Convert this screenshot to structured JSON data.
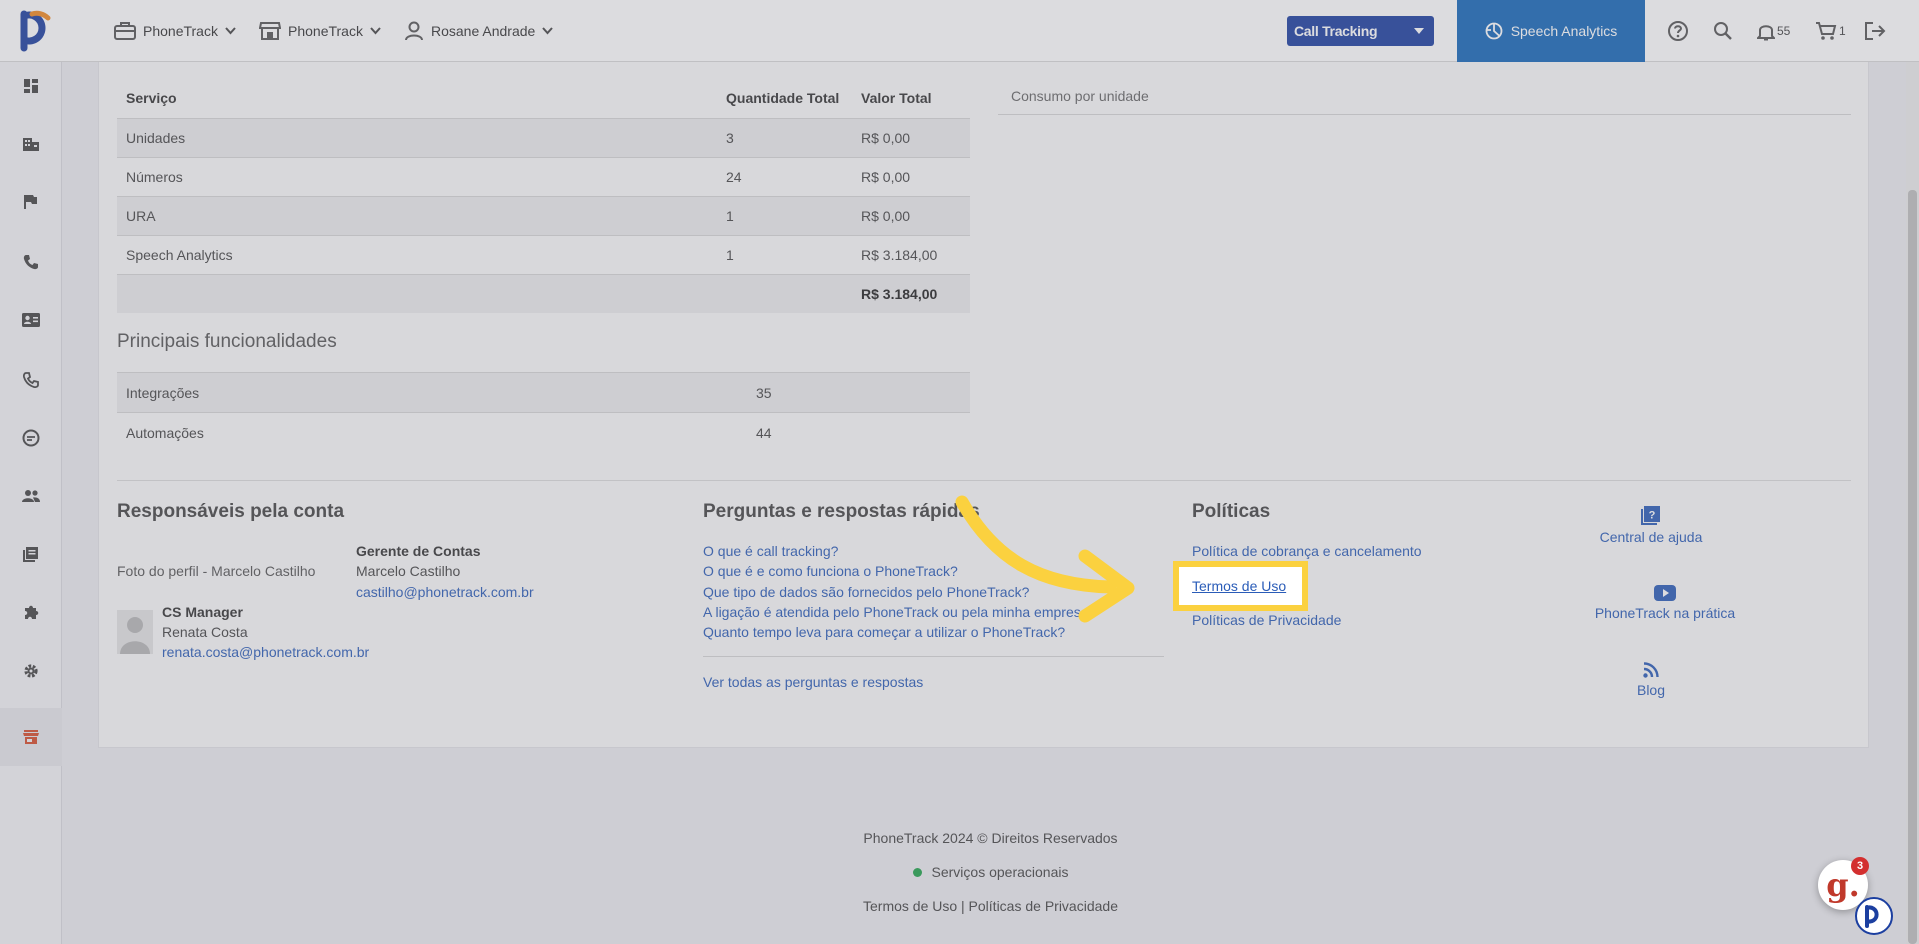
{
  "header": {
    "nav": [
      {
        "label": "PhoneTrack",
        "icon": "briefcase-icon"
      },
      {
        "label": "PhoneTrack",
        "icon": "store-icon"
      },
      {
        "label": "Rosane Andrade",
        "icon": "user-icon"
      }
    ],
    "product_select": "Call Tracking",
    "speech_tab": "Speech Analytics",
    "notifications_count": "55",
    "cart_count": "1",
    "icons": [
      "help-icon",
      "search-icon",
      "bell-icon",
      "cart-icon",
      "logout-icon"
    ]
  },
  "sidebar": {
    "icons": [
      "dashboard-icon",
      "building-icon",
      "flag-icon",
      "phone-icon",
      "contact-card-icon",
      "phone-call-icon",
      "speech-icon",
      "team-icon",
      "library-icon",
      "puzzle-icon",
      "gear-icon",
      "store-icon"
    ]
  },
  "services": {
    "headers": [
      "Serviço",
      "Quantidade Total",
      "Valor Total"
    ],
    "rows": [
      {
        "name": "Unidades",
        "qty": "3",
        "value": "R$ 0,00"
      },
      {
        "name": "Números",
        "qty": "24",
        "value": "R$ 0,00"
      },
      {
        "name": "URA",
        "qty": "1",
        "value": "R$ 0,00"
      },
      {
        "name": "Speech Analytics",
        "qty": "1",
        "value": "R$ 3.184,00"
      }
    ],
    "total": "R$ 3.184,00"
  },
  "consumo_title": "Consumo por unidade",
  "features": {
    "title": "Principais funcionalidades",
    "rows": [
      {
        "name": "Integrações",
        "count": "35"
      },
      {
        "name": "Automações",
        "count": "44"
      }
    ]
  },
  "responsaveis": {
    "title": "Responsáveis pela conta",
    "gerente": {
      "role": "Gerente de Contas",
      "photo_alt": "Foto do perfil - Marcelo Castilho",
      "name": "Marcelo Castilho",
      "email": "castilho@phonetrack.com.br"
    },
    "cs": {
      "role": "CS Manager",
      "name": "Renata Costa",
      "email": "renata.costa@phonetrack.com.br"
    }
  },
  "faq": {
    "title": "Perguntas e respostas rápidas",
    "items": [
      "O que é call tracking?",
      "O que é e como funciona o PhoneTrack?",
      "Que tipo de dados são fornecidos pelo PhoneTrack?",
      "A ligação é atendida pelo PhoneTrack ou pela minha empresa?",
      "Quanto tempo leva para começar a utilizar o PhoneTrack?"
    ],
    "see_all": "Ver todas as perguntas e respostas"
  },
  "policies": {
    "title": "Políticas",
    "items": [
      "Política de cobrança e cancelamento",
      "Termos de Uso",
      "Políticas de Privacidade"
    ]
  },
  "resources": [
    {
      "label": "Central de ajuda",
      "icon": "help-book-icon"
    },
    {
      "label": "PhoneTrack na prática",
      "icon": "youtube-icon"
    },
    {
      "label": "Blog",
      "icon": "rss-icon"
    }
  ],
  "footer": {
    "copyright": "PhoneTrack 2024 © Direitos Reservados",
    "status": "Serviços operacionais",
    "links": "Termos de Uso | Políticas de Privacidade"
  },
  "widget": {
    "letter": "g.",
    "badge": "3"
  },
  "colors": {
    "accent": "#1c3fa0",
    "speech_tab": "#1667b9",
    "highlight": "#fbd13f",
    "status_ok": "#1fa34a"
  }
}
